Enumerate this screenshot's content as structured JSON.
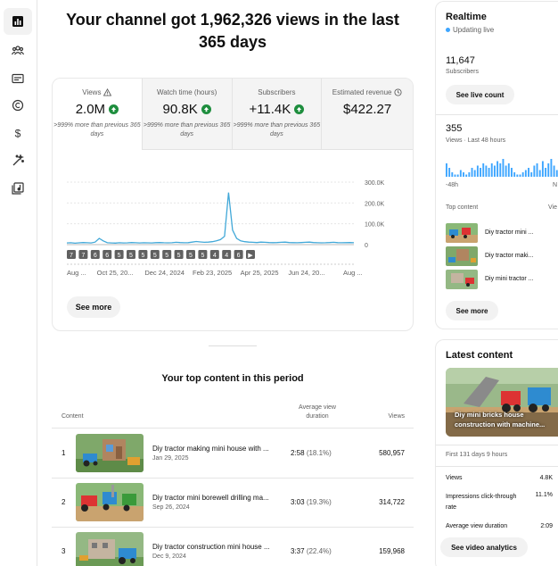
{
  "headline": "Your channel got 1,962,326 views in the last 365 days",
  "metrics": [
    {
      "label": "Views",
      "value": "2.0M",
      "note": ">999% more than previous 365 days"
    },
    {
      "label": "Watch time (hours)",
      "value": "90.8K",
      "note": ">999% more than previous 365 days"
    },
    {
      "label": "Subscribers",
      "value": "+11.4K",
      "note": ">999% more than previous 365 days"
    },
    {
      "label": "Estimated revenue",
      "value": "$422.27",
      "note": ""
    }
  ],
  "chart_data": {
    "type": "line",
    "series_color": "#41a8d8",
    "x_labels": [
      "Aug ...",
      "Oct 25, 20...",
      "Dec 24, 2024",
      "Feb 23, 2025",
      "Apr 25, 2025",
      "Jun 24, 20...",
      "Aug ..."
    ],
    "y_ticks": [
      "300.0K",
      "200.0K",
      "100.0K",
      "0"
    ],
    "ylim": [
      0,
      300000
    ],
    "values": [
      8000,
      9000,
      7000,
      8500,
      10000,
      9000,
      8000,
      12000,
      30000,
      18000,
      9000,
      8000,
      7500,
      9000,
      8000,
      8500,
      10000,
      9000,
      8000,
      9000,
      8500,
      8000,
      9500,
      10000,
      9000,
      8500,
      9000,
      11000,
      10000,
      9000,
      9500,
      12000,
      15000,
      13000,
      11000,
      12000,
      14000,
      18000,
      24000,
      40000,
      250000,
      70000,
      30000,
      18000,
      14000,
      12000,
      11000,
      10000,
      12000,
      11000,
      10000,
      9500,
      10000,
      11000,
      12000,
      10000,
      9500,
      9000,
      10000,
      11000,
      12000,
      10000,
      9000,
      8500,
      9000,
      10000,
      11000,
      9500,
      9000,
      9500,
      10000,
      9000
    ],
    "markers": [
      "7",
      "7",
      "6",
      "6",
      "5",
      "5",
      "5",
      "5",
      "5",
      "5",
      "5",
      "5",
      "4",
      "4",
      "6",
      "▶"
    ]
  },
  "see_more": "See more",
  "top_content": {
    "title": "Your top content in this period",
    "col_content": "Content",
    "col_avg": "Average view duration",
    "col_views": "Views",
    "rows": [
      {
        "rank": "1",
        "title": "Diy tractor making mini house with ...",
        "date": "Jan 29, 2025",
        "avg": "2:58",
        "pct": "(18.1%)",
        "views": "580,957"
      },
      {
        "rank": "2",
        "title": "Diy tractor mini borewell drilling ma...",
        "date": "Sep 26, 2024",
        "avg": "3:03",
        "pct": "(19.3%)",
        "views": "314,722"
      },
      {
        "rank": "3",
        "title": "Diy tractor construction mini house ...",
        "date": "Dec 9, 2024",
        "avg": "3:37",
        "pct": "(22.4%)",
        "views": "159,968"
      }
    ]
  },
  "realtime": {
    "title": "Realtime",
    "status": "Updating live",
    "subs_value": "11,647",
    "subs_label": "Subscribers",
    "live_button": "See live count",
    "views_value": "355",
    "views_label": "Views · Last 48 hours",
    "axis_left": "-48h",
    "axis_right": "N",
    "top_content_label": "Top content",
    "top_content_col": "Vie",
    "items": [
      "Diy tractor mini ...",
      "Diy tractor maki...",
      "Diy mini tractor ..."
    ],
    "bars": [
      6,
      4,
      2,
      1,
      1,
      3,
      2,
      1,
      2,
      4,
      3,
      5,
      4,
      6,
      5,
      4,
      6,
      5,
      7,
      6,
      8,
      5,
      6,
      4,
      2,
      1,
      1,
      2,
      3,
      4,
      2,
      5,
      6,
      3,
      7,
      4,
      6,
      8,
      5,
      3
    ],
    "see_more": "See more"
  },
  "latest": {
    "title": "Latest content",
    "caption": "Diy mini bricks house construction with machine...",
    "age": "First 131 days 9 hours",
    "stats": [
      {
        "label": "Views",
        "value": "4.8K"
      },
      {
        "label": "Impressions click-through rate",
        "value": "11.1%"
      },
      {
        "label": "Average view duration",
        "value": "2:09"
      }
    ],
    "button": "See video analytics"
  }
}
